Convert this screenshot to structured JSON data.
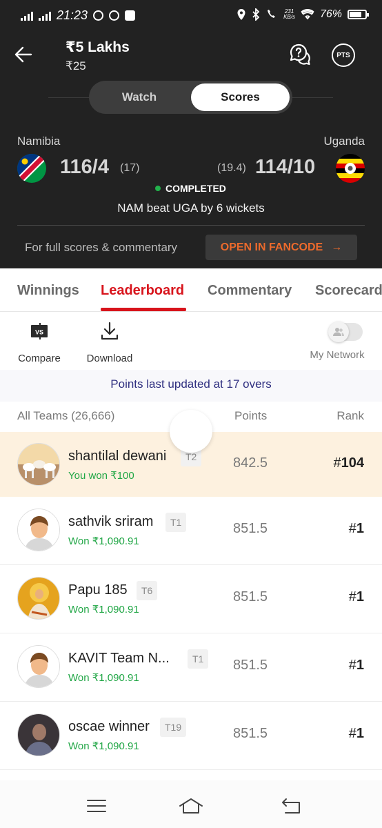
{
  "status_bar": {
    "time": "21:23",
    "net_speed_value": "231",
    "net_speed_unit": "KB/s",
    "battery": "76%"
  },
  "header": {
    "contest_title": "₹5 Lakhs",
    "entry_fee": "₹25",
    "pts_label": "PTS",
    "icons": [
      "back-arrow-icon",
      "help-chat-icon",
      "pts-icon"
    ]
  },
  "toggle": {
    "watch_label": "Watch",
    "scores_label": "Scores",
    "selected": "Scores"
  },
  "match": {
    "team1": {
      "name": "Namibia",
      "score": "116/4",
      "overs": "(17)"
    },
    "team2": {
      "name": "Uganda",
      "score": "114/10",
      "overs": "(19.4)"
    },
    "status": "COMPLETED",
    "result": "NAM beat UGA by 6 wickets",
    "fancode_prompt": "For full scores & commentary",
    "fancode_button": "OPEN IN FANCODE",
    "fancode_arrow": "→"
  },
  "tabs": [
    {
      "label": "Winnings",
      "active": false
    },
    {
      "label": "Leaderboard",
      "active": true
    },
    {
      "label": "Commentary",
      "active": false
    },
    {
      "label": "Scorecard",
      "active": false
    }
  ],
  "tools": {
    "compare_label": "Compare",
    "compare_icon_text": "VS",
    "download_label": "Download",
    "my_network_label": "My Network",
    "my_network_on": false
  },
  "updated_text": "Points last updated at 17 overs",
  "leaderboard": {
    "team_header": "All Teams (26,666)",
    "points_header": "Points",
    "rank_header": "Rank",
    "rows": [
      {
        "name": "shantilal dewani",
        "team": "T2",
        "winnings": "You won ₹100",
        "points": "842.5",
        "rank_hash": "#",
        "rank": "104",
        "mine": true
      },
      {
        "name": "sathvik sriram",
        "team": "T1",
        "winnings": "Won ₹1,090.91",
        "points": "851.5",
        "rank_hash": "#",
        "rank": "1",
        "mine": false
      },
      {
        "name": "Papu 185",
        "team": "T6",
        "winnings": "Won ₹1,090.91",
        "points": "851.5",
        "rank_hash": "#",
        "rank": "1",
        "mine": false
      },
      {
        "name": "KAVIT Team N...",
        "team": "T1",
        "winnings": "Won ₹1,090.91",
        "points": "851.5",
        "rank_hash": "#",
        "rank": "1",
        "mine": false
      },
      {
        "name": "oscae winner",
        "team": "T19",
        "winnings": "Won ₹1,090.91",
        "points": "851.5",
        "rank_hash": "#",
        "rank": "1",
        "mine": false
      }
    ]
  },
  "colors": {
    "accent_red": "#d8141c",
    "fancode_orange": "#ec6a2c",
    "win_green": "#20a645",
    "header_bg": "#222222",
    "my_row_bg": "#fdf1df"
  },
  "navigation_bar": [
    "menu-icon",
    "home-icon",
    "back-icon"
  ]
}
